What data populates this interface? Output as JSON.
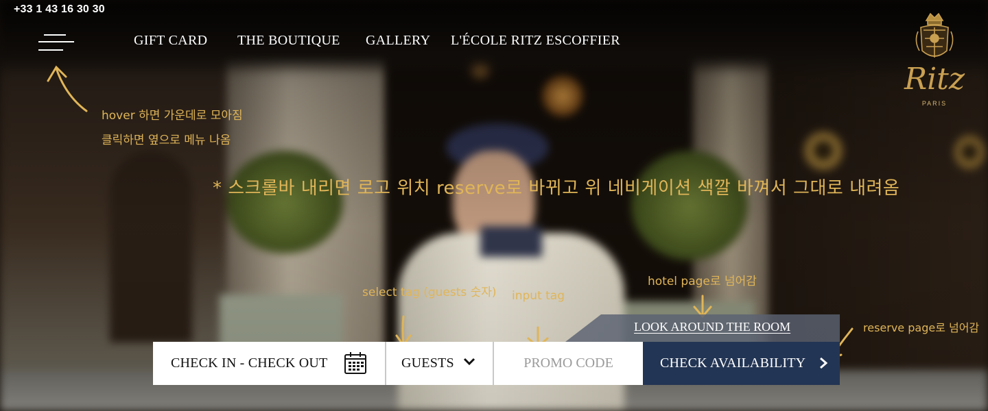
{
  "header": {
    "phone": "+33 1 43 16 30 30",
    "nav": [
      {
        "label": "GIFT CARD"
      },
      {
        "label": "THE BOUTIQUE"
      },
      {
        "label": "GALLERY"
      },
      {
        "label": "L'ÉCOLE RITZ ESCOFFIER"
      }
    ],
    "logo": {
      "wordmark": "Ritz",
      "subtitle": "PARIS"
    }
  },
  "annotations": {
    "menu_hover": "hover 하면 가운데로 모아짐",
    "menu_click": "클릭하면 옆으로 메뉴 나옴",
    "scroll_note": "* 스크롤바 내리면 로고 위치 reserve로 바뀌고 위 네비게이션 색깔 바껴서 그대로 내려옴",
    "select_tag": "select tag (guests 숫자)",
    "input_tag": "input tag",
    "hotel_page": "hotel page로 넘어감",
    "reserve_page": "reserve page로 넘어감"
  },
  "look_around": {
    "label": "LOOK AROUND THE ROOM"
  },
  "booking": {
    "dates_label": "CHECK IN - CHECK OUT",
    "guests_label": "GUESTS",
    "promo_placeholder": "PROMO CODE",
    "check_label": "CHECK AVAILABILITY"
  },
  "colors": {
    "accent_gold": "#c9a052",
    "annotation": "#e0b558",
    "cta_navy": "#233554"
  },
  "icons": [
    "menu-icon",
    "calendar-icon",
    "chevron-down-icon",
    "chevron-right-icon",
    "ritz-crest-icon"
  ]
}
